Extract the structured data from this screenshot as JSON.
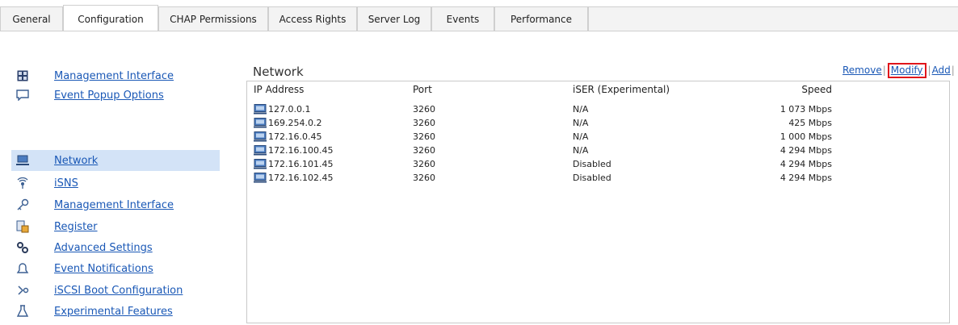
{
  "tabs": [
    {
      "label": "General"
    },
    {
      "label": "Configuration",
      "active": true
    },
    {
      "label": "CHAP Permissions"
    },
    {
      "label": "Access Rights"
    },
    {
      "label": "Server Log"
    },
    {
      "label": "Events"
    },
    {
      "label": "Performance"
    }
  ],
  "sidebar": {
    "top_items": [
      {
        "label": "Management Interface",
        "icon": "management-grid-icon"
      },
      {
        "label": "Event Popup Options",
        "icon": "popup-icon"
      }
    ],
    "items": [
      {
        "label": "Network",
        "icon": "network-icon",
        "selected": true
      },
      {
        "label": "iSNS",
        "icon": "isns-icon"
      },
      {
        "label": "Management Interface",
        "icon": "key-icon"
      },
      {
        "label": "Register",
        "icon": "register-icon"
      },
      {
        "label": "Advanced Settings",
        "icon": "gears-icon"
      },
      {
        "label": "Event Notifications",
        "icon": "bell-icon"
      },
      {
        "label": "iSCSI Boot Configuration",
        "icon": "boot-icon"
      },
      {
        "label": "Experimental Features",
        "icon": "flask-icon"
      }
    ]
  },
  "main": {
    "section_title": "Network",
    "actions": {
      "remove": "Remove",
      "modify": "Modify",
      "add": "Add"
    },
    "table": {
      "columns": [
        "IP Address",
        "Port",
        "iSER (Experimental)",
        "Speed"
      ],
      "rows": [
        {
          "ip": "127.0.0.1",
          "port": "3260",
          "iser": "N/A",
          "speed": "1 073 Mbps"
        },
        {
          "ip": "169.254.0.2",
          "port": "3260",
          "iser": "N/A",
          "speed": "425 Mbps"
        },
        {
          "ip": "172.16.0.45",
          "port": "3260",
          "iser": "N/A",
          "speed": "1 000 Mbps"
        },
        {
          "ip": "172.16.100.45",
          "port": "3260",
          "iser": "N/A",
          "speed": "4 294 Mbps"
        },
        {
          "ip": "172.16.101.45",
          "port": "3260",
          "iser": "Disabled",
          "speed": "4 294 Mbps"
        },
        {
          "ip": "172.16.102.45",
          "port": "3260",
          "iser": "Disabled",
          "speed": "4 294 Mbps"
        }
      ]
    }
  },
  "colors": {
    "link": "#1a58b6",
    "selected_bg": "#d3e3f7",
    "highlight_border": "#e0151b"
  }
}
